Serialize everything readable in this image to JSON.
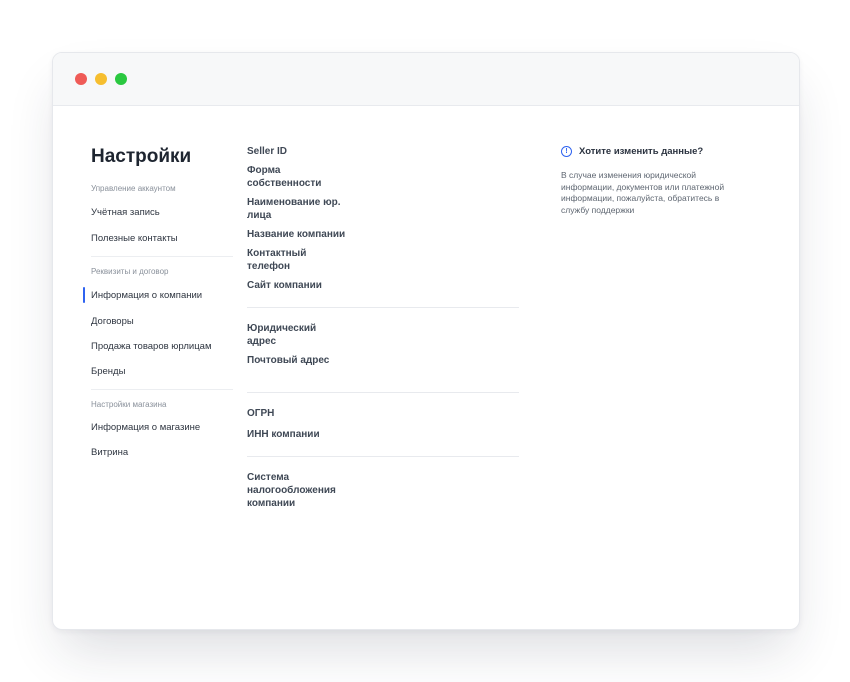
{
  "window": {
    "traffic_lights": [
      {
        "name": "close",
        "color": "#ef5b57"
      },
      {
        "name": "minimize",
        "color": "#f6be2f"
      },
      {
        "name": "maximize",
        "color": "#2ac840"
      }
    ]
  },
  "sidebar": {
    "title": "Настройки",
    "sections": [
      {
        "label": "Управление аккаунтом",
        "items": [
          "Учётная запись",
          "Полезные контакты"
        ]
      },
      {
        "label": "Реквизиты и договор",
        "items": [
          "Информация о компании",
          "Договоры",
          "Продажа товаров юрлицам",
          "Бренды"
        ]
      },
      {
        "label": "Настройки магазина",
        "items": [
          "Информация о магазине",
          "Витрина"
        ]
      }
    ],
    "active_item": "Информация о компании",
    "accent_color": "#2f63f0"
  },
  "fields": {
    "group1": [
      "Seller ID",
      "Форма собственности",
      "Наименование юр. лица",
      "Название компании",
      "Контактный телефон",
      "Сайт компании"
    ],
    "group2": [
      "Юридический адрес",
      "Почтовый адрес"
    ],
    "group3": [
      "ОГРН",
      "ИНН компании"
    ],
    "group4": [
      "Система налогообложения компании"
    ]
  },
  "info": {
    "icon": "info-circle-icon",
    "title": "Хотите изменить данные?",
    "text": "В случае изменения юридической информации, документов или платежной информации, пожалуйста, обратитесь в службу поддержки"
  }
}
